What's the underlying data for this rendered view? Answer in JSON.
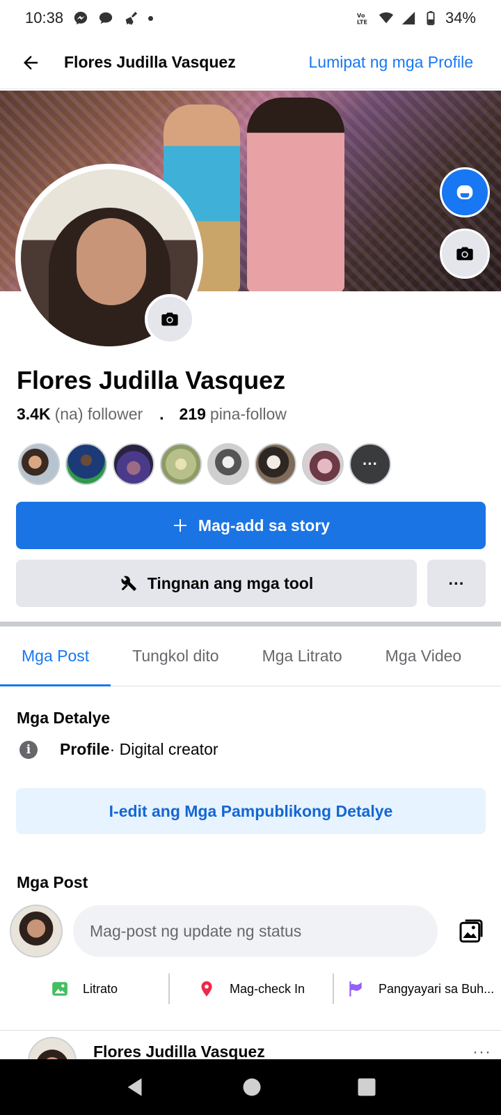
{
  "status_bar": {
    "time": "10:38",
    "battery": "34%",
    "icons": [
      "messenger-icon",
      "chat-bubble-icon",
      "broom-icon",
      "dot-icon",
      "volte-icon",
      "wifi-icon",
      "signal-icon",
      "battery-icon"
    ]
  },
  "app_bar": {
    "title": "Flores Judilla Vasquez",
    "switch_link": "Lumipat ng mga Profile"
  },
  "profile": {
    "name": "Flores Judilla Vasquez",
    "followers_count": "3.4K",
    "followers_label": "(na) follower",
    "separator": ".",
    "following_count": "219",
    "following_label": "pina-follow",
    "more_friends": "···"
  },
  "buttons": {
    "add_story": "Mag-add sa story",
    "view_tools": "Tingnan ang mga tool",
    "more": "···",
    "edit_details": "I-edit ang Mga Pampublikong Detalye"
  },
  "tabs": [
    {
      "label": "Mga Post",
      "active": true
    },
    {
      "label": "Tungkol dito",
      "active": false
    },
    {
      "label": "Mga Litrato",
      "active": false
    },
    {
      "label": "Mga Video",
      "active": false
    }
  ],
  "details": {
    "title": "Mga Detalye",
    "type_label": "Profile",
    "type_value": " · Digital creator"
  },
  "posts": {
    "title": "Mga Post",
    "composer_placeholder": "Mag-post ng update ng status",
    "actions": [
      {
        "label": "Litrato",
        "icon": "photo-icon",
        "color": "#45bd62"
      },
      {
        "label": "Mag-check In",
        "icon": "location-pin-icon",
        "color": "#f02849"
      },
      {
        "label": "Pangyayari sa Buh...",
        "icon": "flag-icon",
        "color": "#9360f7"
      }
    ],
    "first_post_author": "Flores Judilla Vasquez",
    "first_post_menu": "···"
  },
  "colors": {
    "accent": "#1877f2",
    "button_grey": "#e4e6eb",
    "text_secondary": "#65676b"
  }
}
